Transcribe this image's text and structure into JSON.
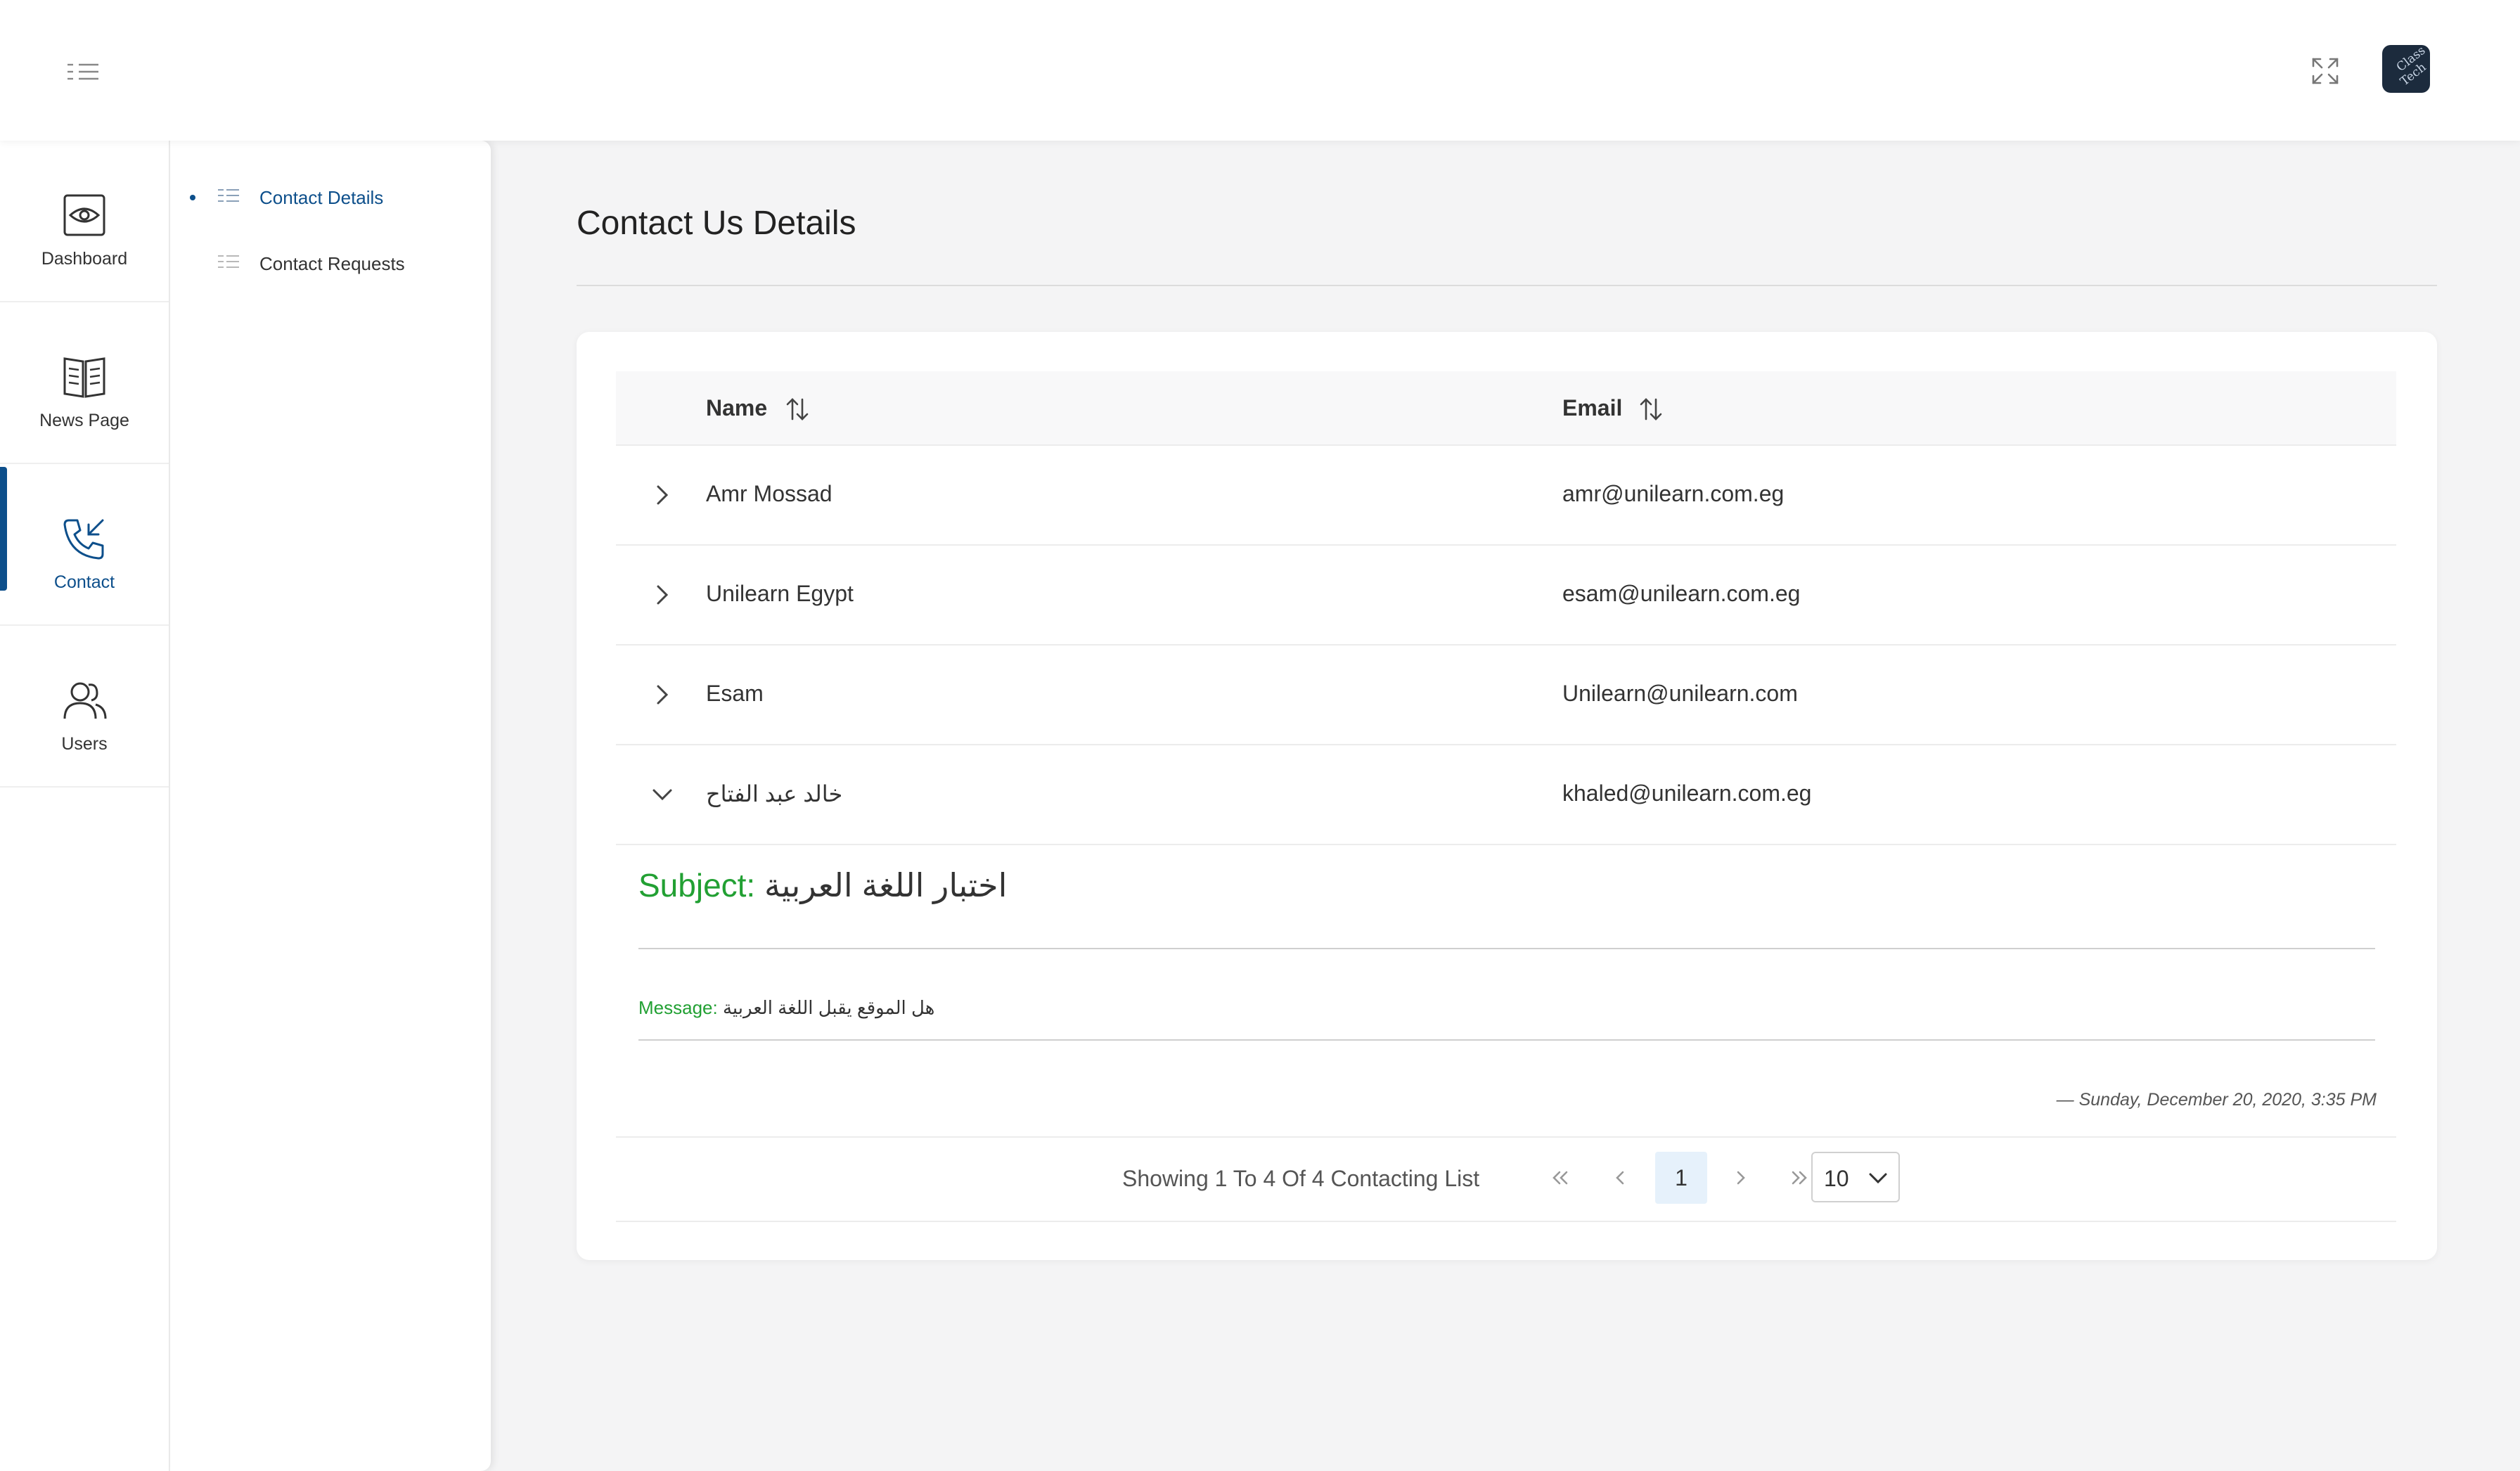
{
  "header": {
    "menu_icon": "menu-list-icon",
    "fullscreen_icon": "expand-icon",
    "logo_text_line1": "Class",
    "logo_text_line2": "Tech"
  },
  "rail": {
    "items": [
      {
        "label": "Dashboard",
        "icon": "eye-icon",
        "active": false
      },
      {
        "label": "News Page",
        "icon": "newspaper-icon",
        "active": false
      },
      {
        "label": "Contact",
        "icon": "phone-incoming-icon",
        "active": true
      },
      {
        "label": "Users",
        "icon": "users-icon",
        "active": false
      }
    ]
  },
  "submenu": {
    "items": [
      {
        "label": "Contact Details",
        "active": true
      },
      {
        "label": "Contact Requests",
        "active": false
      }
    ]
  },
  "main": {
    "title": "Contact Us Details",
    "table": {
      "columns": [
        "Name",
        "Email"
      ],
      "rows": [
        {
          "name": "Amr Mossad",
          "email": "amr@unilearn.com.eg",
          "expanded": false
        },
        {
          "name": "Unilearn Egypt",
          "email": "esam@unilearn.com.eg",
          "expanded": false
        },
        {
          "name": "Esam",
          "email": "Unilearn@unilearn.com",
          "expanded": false
        },
        {
          "name": "خالد عبد الفتاح",
          "email": "khaled@unilearn.com.eg",
          "expanded": true
        }
      ]
    },
    "detail": {
      "subject_label": "Subject:",
      "subject_value": "اختبار اللغة العربية",
      "message_label": "Message:",
      "message_value": "هل الموقع يقبل اللغة العربية",
      "date": "— Sunday, December 20, 2020, 3:35 PM"
    },
    "pagination": {
      "summary": "Showing 1 To 4 Of 4 Contacting List",
      "current_page": "1",
      "page_size": "10"
    }
  },
  "colors": {
    "accent": "#0d4f8b",
    "label_green": "#22a033",
    "current_page_bg": "#e6f1fb"
  }
}
